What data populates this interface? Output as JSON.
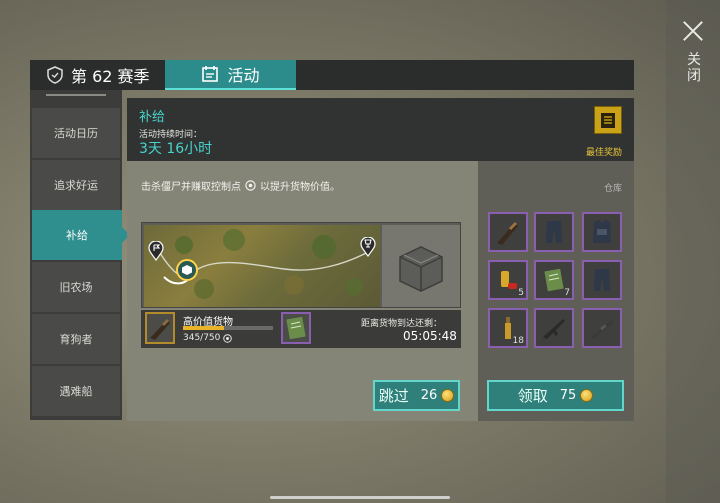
{
  "close": {
    "label": "关闭"
  },
  "tabs": {
    "season": "第 62 赛季",
    "activity": "活动"
  },
  "sidebar": {
    "items": [
      {
        "label": "活动日历"
      },
      {
        "label": "追求好运"
      },
      {
        "label": "补给",
        "active": true
      },
      {
        "label": "旧农场"
      },
      {
        "label": "育狗者"
      },
      {
        "label": "遇难船"
      }
    ]
  },
  "header": {
    "title": "补给",
    "duration_label": "活动持续时间：",
    "duration_value": "3天 16小时",
    "best_reward": "最佳奖励"
  },
  "body": {
    "description": "击杀僵尸并赚取控制点",
    "description_suffix": "以提升货物价值。"
  },
  "cargo": {
    "label": "高价值货物",
    "progress_text": "345/750",
    "progress": 0.46
  },
  "arrival": {
    "label": "距离货物到达还剩：",
    "time": "05:05:48"
  },
  "warehouse": {
    "label": "仓库",
    "items": [
      {
        "icon": "shotgun-icon",
        "qty": ""
      },
      {
        "icon": "armor-pants-icon",
        "qty": ""
      },
      {
        "icon": "armor-vest-icon",
        "qty": ""
      },
      {
        "icon": "ammo-shells-icon",
        "qty": "5"
      },
      {
        "icon": "notebook-icon",
        "qty": "7"
      },
      {
        "icon": "armor-pants-icon",
        "qty": ""
      },
      {
        "icon": "molotov-icon",
        "qty": "18"
      },
      {
        "icon": "assault-rifle-icon",
        "qty": ""
      },
      {
        "icon": "rifle-icon",
        "qty": ""
      }
    ]
  },
  "buttons": {
    "skip_label": "跳过",
    "skip_cost": "26",
    "claim_label": "领取",
    "claim_cost": "75"
  },
  "colors": {
    "accent": "#2f8f8e",
    "highlight": "#48d4cc",
    "rarity": "#8a5fb0"
  }
}
